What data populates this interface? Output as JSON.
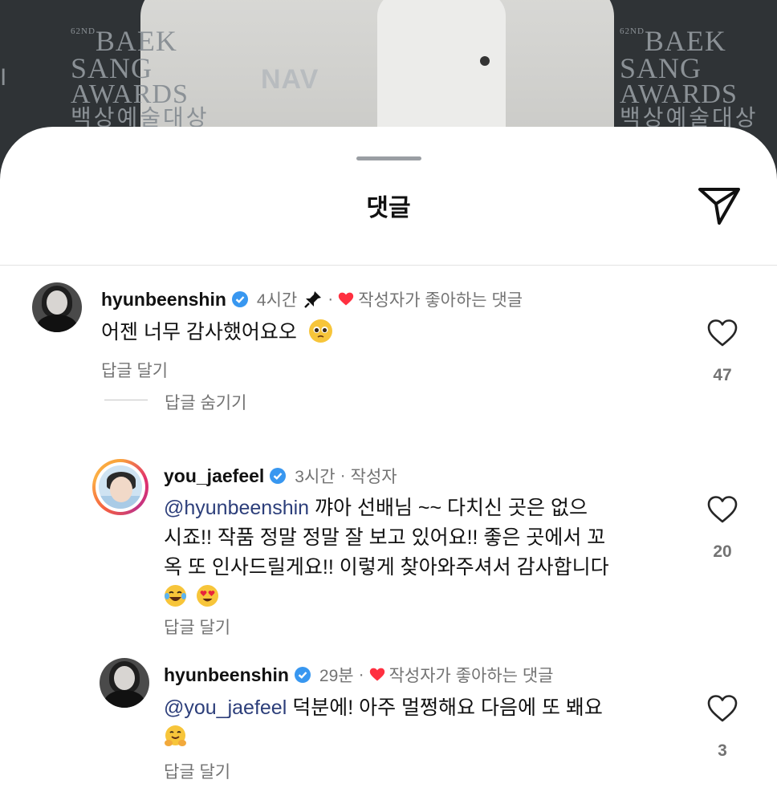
{
  "background": {
    "award_left": {
      "sup": "62ND",
      "line1": "BAEK",
      "line2": "SANG",
      "line3": "AWARDS",
      "line4": "백상예술대상"
    },
    "award_right": {
      "sup": "62ND",
      "line1": "BAEK",
      "line2": "SANG",
      "line3": "AWARDS",
      "line4": "백상예술대상"
    },
    "sponsor_mark": "NAV",
    "edge_mark": "I"
  },
  "sheet": {
    "title": "댓글",
    "share_icon": "send-icon"
  },
  "comments": [
    {
      "username": "hyunbeenshin",
      "verified": true,
      "time": "4시간",
      "pinned": true,
      "separator": "·",
      "author_liked_label": "작성자가 좋아하는 댓글",
      "text": "어젠 너무 감사했어요오",
      "emoji": "pleading-face",
      "reply_label": "답글 달기",
      "like_count": "47",
      "hide_replies_label": "답글 숨기기",
      "replies": [
        {
          "username": "you_jaefeel",
          "verified": true,
          "time": "3시간",
          "separator": "·",
          "author_badge": "작성자",
          "mention": "@hyunbeenshin",
          "text_line1": " 꺄아 선배님 ~~ 다치신 곳은 없으",
          "text_line2": "시죠!! 작품 정말 정말 잘 보고 있어요!! 좋은 곳에서 꼬",
          "text_line3": "옥 또 인사드릴게요!! 이렇게 찾아와주셔서 감사합니다",
          "emojis": [
            "face-with-tears-of-joy",
            "smiling-face-with-heart-eyes"
          ],
          "reply_label": "답글 달기",
          "like_count": "20"
        },
        {
          "username": "hyunbeenshin",
          "verified": true,
          "time": "29분",
          "separator": "·",
          "author_liked_label": "작성자가 좋아하는 댓글",
          "mention": "@you_jaefeel",
          "text_line1": " 덕분에! 아주 멀쩡해요 다음에 또 봬요",
          "emoji": "hugging-face",
          "reply_label": "답글 달기",
          "like_count": "3"
        }
      ]
    }
  ],
  "colors": {
    "heart_red": "#ff3040",
    "verified_blue": "#3897f0",
    "mention": "#2c3e7a",
    "muted": "#737373"
  }
}
